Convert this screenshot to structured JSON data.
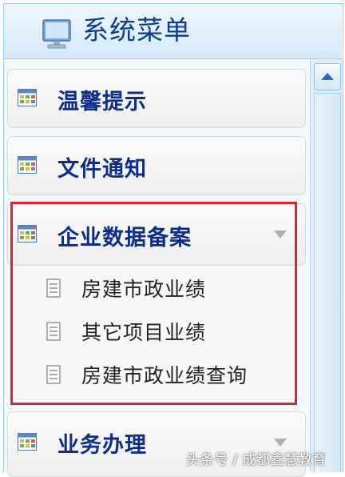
{
  "header": {
    "title": "系统菜单",
    "icon": "monitor-icon"
  },
  "menu": {
    "items": [
      {
        "label": "温馨提示",
        "icon": "grid-icon"
      },
      {
        "label": "文件通知",
        "icon": "grid-icon"
      },
      {
        "label": "企业数据备案",
        "icon": "grid-icon",
        "expanded": true
      },
      {
        "label": "业务办理",
        "icon": "grid-icon",
        "expanded": false
      }
    ],
    "submenu": [
      {
        "label": "房建市政业绩",
        "icon": "document-icon"
      },
      {
        "label": "其它项目业绩",
        "icon": "document-icon"
      },
      {
        "label": "房建市政业绩查询",
        "icon": "document-icon"
      }
    ]
  },
  "highlight_color": "#e0222e",
  "watermark": "头条号 / 成都鑫慧教育"
}
